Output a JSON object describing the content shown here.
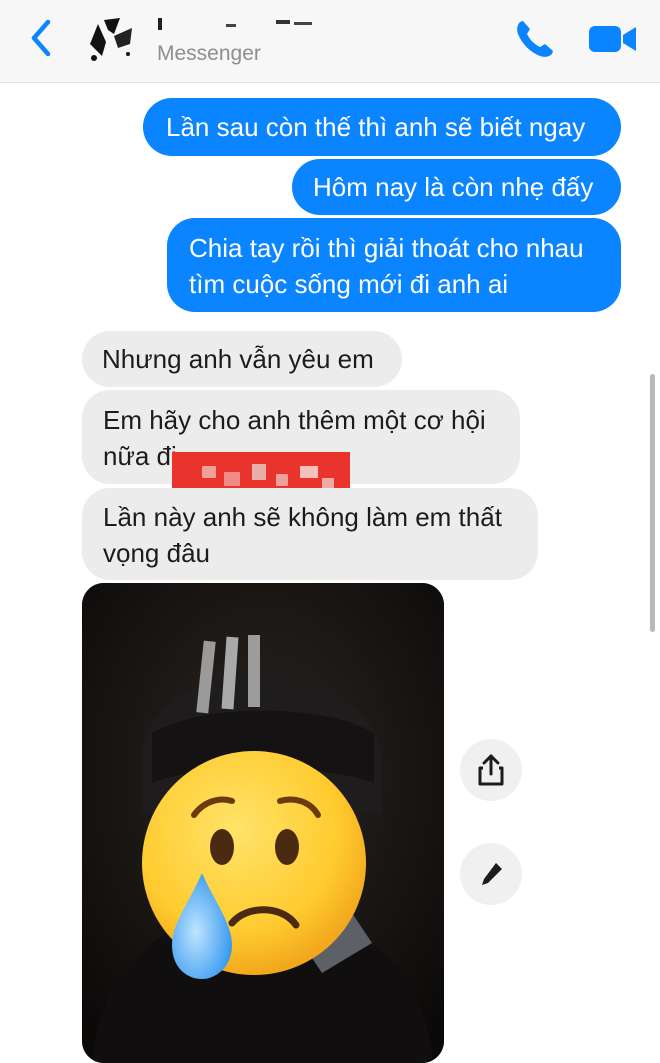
{
  "header": {
    "subtitle": "Messenger",
    "accent": "#0a84ff"
  },
  "icons": {
    "back": "chevron-left-icon",
    "call": "phone-icon",
    "video": "video-camera-icon",
    "share": "share-icon",
    "edit": "pencil-icon"
  },
  "messages": {
    "m1": "Lần sau còn thế thì anh sẽ biết ngay",
    "m2": "Hôm nay là còn nhẹ đấy",
    "m3_line1": "Chia tay rồi thì giải thoát cho nhau",
    "m3_line2": "tìm cuộc sống mới đi anh ai",
    "m4": "Nhưng anh vẫn yêu em",
    "m5_line1": "Em hãy cho anh thêm một cơ hội",
    "m5_line2": "nữa đi",
    "m6_line1": "Lần này anh sẽ không làm em thất",
    "m6_line2": "vọng đâu"
  },
  "colors": {
    "outgoing_bubble": "#0a84ff",
    "incoming_bubble": "#ececec",
    "redaction": "#e8342d"
  }
}
